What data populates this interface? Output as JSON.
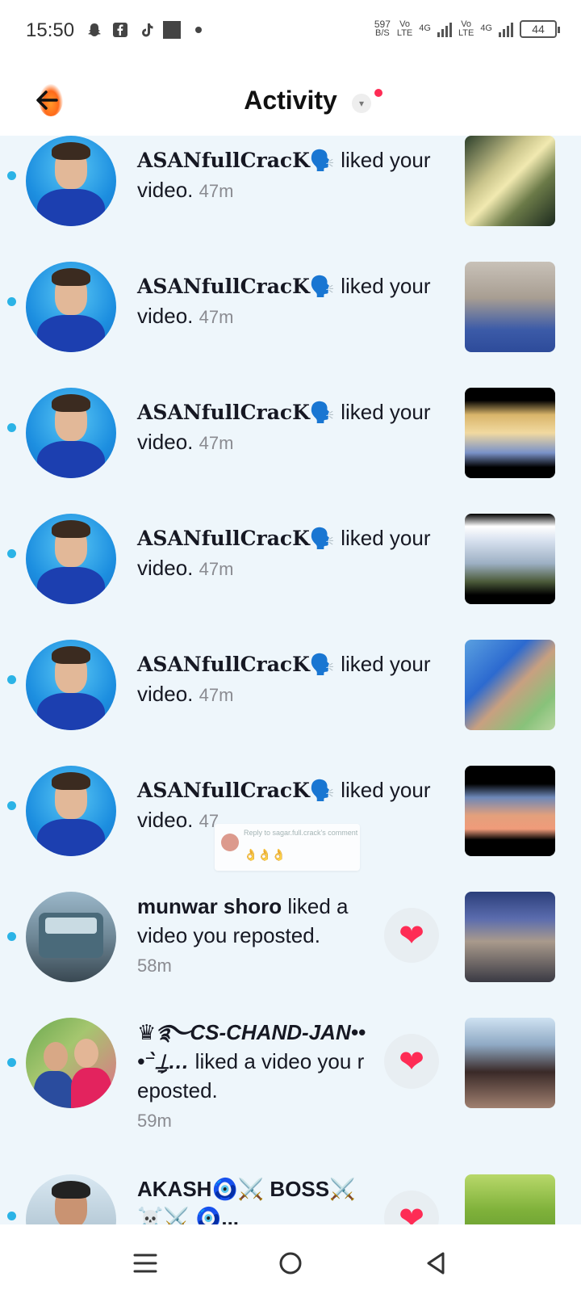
{
  "status_bar": {
    "time": "15:50",
    "net_speed": "597",
    "net_unit": "B/S",
    "sim1_tag_top": "Vo",
    "sim1_tag_bottom": "LTE",
    "sim1_gen": "4G",
    "sim2_tag_top": "Vo",
    "sim2_tag_bottom": "LTE",
    "sim2_gen": "4G",
    "battery": "44",
    "icons": [
      "snapchat-icon",
      "facebook-icon",
      "tiktok-icon",
      "gallery-icon",
      "dot-icon"
    ]
  },
  "header": {
    "title": "Activity",
    "back_icon": "back-arrow-icon",
    "caret": "▾",
    "accent": "#fe2c55"
  },
  "feed": {
    "rows": [
      {
        "username": "ASANfullCracK🗣️",
        "action": " liked your video.",
        "time": "47m"
      },
      {
        "username": "ASANfullCracK🗣️",
        "action": " liked your video.",
        "time": "47m"
      },
      {
        "username": "ASANfullCracK🗣️",
        "action": " liked your video.",
        "time": "47m"
      },
      {
        "username": "ASANfullCracK🗣️",
        "action": " liked your video.",
        "time": "47m"
      },
      {
        "username": "ASANfullCracK🗣️",
        "action": " liked your video.",
        "time": "47m"
      },
      {
        "username": "ASANfullCracK🗣️",
        "action": " liked your video.",
        "time": "47"
      },
      {
        "username": "munwar shoro",
        "action": " liked a video you reposted.",
        "time": "58m"
      },
      {
        "username": "♛࿐CS-CHAND-JAN•••⁻̀⍊̗…",
        "action": " liked a video you reposted.",
        "time": "59m"
      },
      {
        "username": "AKASH🧿⚔️ BOSS⚔️ ☠️⚔️ 🧿...",
        "action": "",
        "time": ""
      }
    ],
    "heart": "❤",
    "popup_text": "Reply to sagar.full.crack's comment",
    "popup_emoji": "👌👌👌",
    "unread_color": "#2bb3e6"
  },
  "nav": {
    "recents": "recents-icon",
    "home": "home-icon",
    "back": "back-icon"
  }
}
